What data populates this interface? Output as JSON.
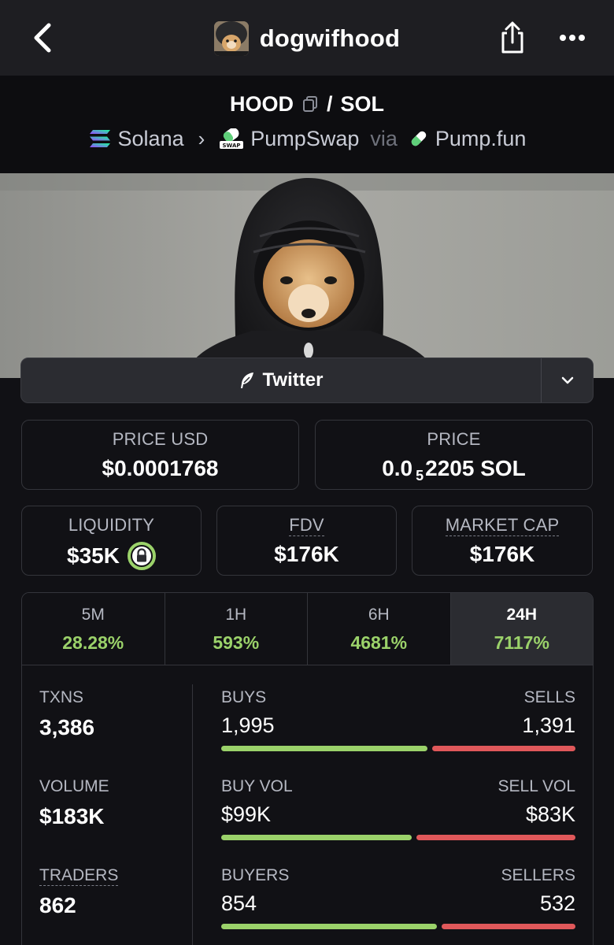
{
  "header": {
    "title": "dogwifhood",
    "back_icon": "chevron-left-icon",
    "share_icon": "share-icon",
    "more_icon": "more-horizontal-icon"
  },
  "pair": {
    "base": "HOOD",
    "slash": "/",
    "quote": "SOL",
    "chain": "Solana",
    "dex": "PumpSwap",
    "via": "via",
    "launchpad": "Pump.fun"
  },
  "social": {
    "label": "Twitter"
  },
  "stats": {
    "price_usd_label": "PRICE USD",
    "price_usd": "$0.0001768",
    "price_label": "PRICE",
    "price_prefix": "0.0",
    "price_zeros": "5",
    "price_suffix": "2205 SOL",
    "liquidity_label": "LIQUIDITY",
    "liquidity": "$35K",
    "fdv_label": "FDV",
    "fdv": "$176K",
    "mcap_label": "MARKET CAP",
    "mcap": "$176K"
  },
  "timeframes": [
    {
      "label": "5M",
      "change": "28.28%"
    },
    {
      "label": "1H",
      "change": "593%"
    },
    {
      "label": "6H",
      "change": "4681%"
    },
    {
      "label": "24H",
      "change": "7117%"
    }
  ],
  "activity": {
    "txns_label": "TXNS",
    "txns": "3,386",
    "buys_label": "BUYS",
    "buys": "1,995",
    "sells_label": "SELLS",
    "sells": "1,391",
    "volume_label": "VOLUME",
    "volume": "$183K",
    "buy_vol_label": "BUY VOL",
    "buy_vol": "$99K",
    "sell_vol_label": "SELL VOL",
    "sell_vol": "$83K",
    "traders_label": "TRADERS",
    "traders": "862",
    "buyers_label": "BUYERS",
    "buyers": "854",
    "sellers_label": "SELLERS",
    "sellers": "532"
  },
  "colors": {
    "positive": "#9bd26a",
    "negative": "#e0585a",
    "background": "#111115"
  }
}
